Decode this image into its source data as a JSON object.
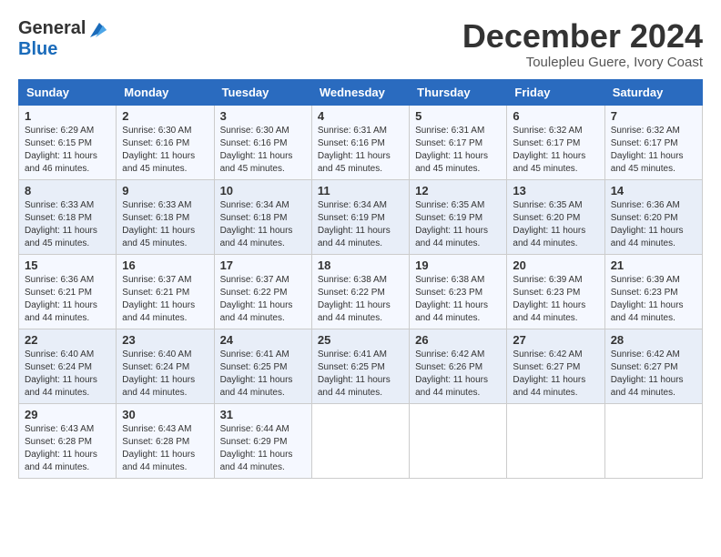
{
  "logo": {
    "general": "General",
    "blue": "Blue"
  },
  "title": "December 2024",
  "location": "Toulepleu Guere, Ivory Coast",
  "days_of_week": [
    "Sunday",
    "Monday",
    "Tuesday",
    "Wednesday",
    "Thursday",
    "Friday",
    "Saturday"
  ],
  "weeks": [
    [
      {
        "day": "1",
        "sunrise": "6:29 AM",
        "sunset": "6:15 PM",
        "daylight": "11 hours and 46 minutes."
      },
      {
        "day": "2",
        "sunrise": "6:30 AM",
        "sunset": "6:16 PM",
        "daylight": "11 hours and 45 minutes."
      },
      {
        "day": "3",
        "sunrise": "6:30 AM",
        "sunset": "6:16 PM",
        "daylight": "11 hours and 45 minutes."
      },
      {
        "day": "4",
        "sunrise": "6:31 AM",
        "sunset": "6:16 PM",
        "daylight": "11 hours and 45 minutes."
      },
      {
        "day": "5",
        "sunrise": "6:31 AM",
        "sunset": "6:17 PM",
        "daylight": "11 hours and 45 minutes."
      },
      {
        "day": "6",
        "sunrise": "6:32 AM",
        "sunset": "6:17 PM",
        "daylight": "11 hours and 45 minutes."
      },
      {
        "day": "7",
        "sunrise": "6:32 AM",
        "sunset": "6:17 PM",
        "daylight": "11 hours and 45 minutes."
      }
    ],
    [
      {
        "day": "8",
        "sunrise": "6:33 AM",
        "sunset": "6:18 PM",
        "daylight": "11 hours and 45 minutes."
      },
      {
        "day": "9",
        "sunrise": "6:33 AM",
        "sunset": "6:18 PM",
        "daylight": "11 hours and 45 minutes."
      },
      {
        "day": "10",
        "sunrise": "6:34 AM",
        "sunset": "6:18 PM",
        "daylight": "11 hours and 44 minutes."
      },
      {
        "day": "11",
        "sunrise": "6:34 AM",
        "sunset": "6:19 PM",
        "daylight": "11 hours and 44 minutes."
      },
      {
        "day": "12",
        "sunrise": "6:35 AM",
        "sunset": "6:19 PM",
        "daylight": "11 hours and 44 minutes."
      },
      {
        "day": "13",
        "sunrise": "6:35 AM",
        "sunset": "6:20 PM",
        "daylight": "11 hours and 44 minutes."
      },
      {
        "day": "14",
        "sunrise": "6:36 AM",
        "sunset": "6:20 PM",
        "daylight": "11 hours and 44 minutes."
      }
    ],
    [
      {
        "day": "15",
        "sunrise": "6:36 AM",
        "sunset": "6:21 PM",
        "daylight": "11 hours and 44 minutes."
      },
      {
        "day": "16",
        "sunrise": "6:37 AM",
        "sunset": "6:21 PM",
        "daylight": "11 hours and 44 minutes."
      },
      {
        "day": "17",
        "sunrise": "6:37 AM",
        "sunset": "6:22 PM",
        "daylight": "11 hours and 44 minutes."
      },
      {
        "day": "18",
        "sunrise": "6:38 AM",
        "sunset": "6:22 PM",
        "daylight": "11 hours and 44 minutes."
      },
      {
        "day": "19",
        "sunrise": "6:38 AM",
        "sunset": "6:23 PM",
        "daylight": "11 hours and 44 minutes."
      },
      {
        "day": "20",
        "sunrise": "6:39 AM",
        "sunset": "6:23 PM",
        "daylight": "11 hours and 44 minutes."
      },
      {
        "day": "21",
        "sunrise": "6:39 AM",
        "sunset": "6:23 PM",
        "daylight": "11 hours and 44 minutes."
      }
    ],
    [
      {
        "day": "22",
        "sunrise": "6:40 AM",
        "sunset": "6:24 PM",
        "daylight": "11 hours and 44 minutes."
      },
      {
        "day": "23",
        "sunrise": "6:40 AM",
        "sunset": "6:24 PM",
        "daylight": "11 hours and 44 minutes."
      },
      {
        "day": "24",
        "sunrise": "6:41 AM",
        "sunset": "6:25 PM",
        "daylight": "11 hours and 44 minutes."
      },
      {
        "day": "25",
        "sunrise": "6:41 AM",
        "sunset": "6:25 PM",
        "daylight": "11 hours and 44 minutes."
      },
      {
        "day": "26",
        "sunrise": "6:42 AM",
        "sunset": "6:26 PM",
        "daylight": "11 hours and 44 minutes."
      },
      {
        "day": "27",
        "sunrise": "6:42 AM",
        "sunset": "6:27 PM",
        "daylight": "11 hours and 44 minutes."
      },
      {
        "day": "28",
        "sunrise": "6:42 AM",
        "sunset": "6:27 PM",
        "daylight": "11 hours and 44 minutes."
      }
    ],
    [
      {
        "day": "29",
        "sunrise": "6:43 AM",
        "sunset": "6:28 PM",
        "daylight": "11 hours and 44 minutes."
      },
      {
        "day": "30",
        "sunrise": "6:43 AM",
        "sunset": "6:28 PM",
        "daylight": "11 hours and 44 minutes."
      },
      {
        "day": "31",
        "sunrise": "6:44 AM",
        "sunset": "6:29 PM",
        "daylight": "11 hours and 44 minutes."
      },
      null,
      null,
      null,
      null
    ]
  ]
}
